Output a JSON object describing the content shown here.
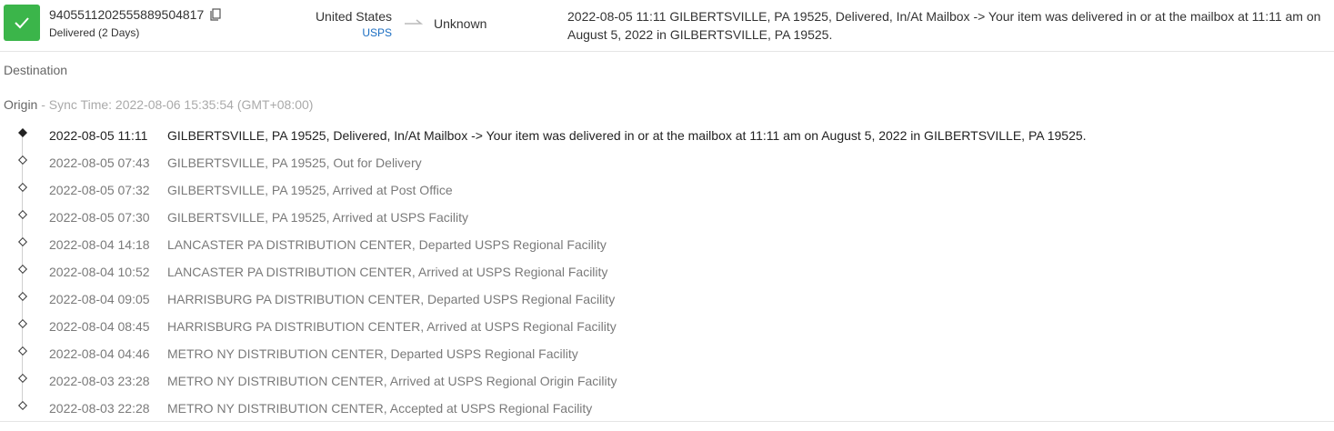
{
  "header": {
    "status_color": "#3bb54a",
    "status_icon": "check-icon",
    "tracking_number": "9405511202555889504817",
    "copy_icon": "copy-icon",
    "status_text": "Delivered (2 Days)",
    "origin_country": "United States",
    "carrier": "USPS",
    "carrier_color": "#1b6ec2",
    "arrow_icon": "arrow-right-icon",
    "destination_country": "Unknown",
    "latest_event": "2022-08-05 11:11  GILBERTSVILLE, PA 19525, Delivered, In/At Mailbox -> Your item was delivered in or at the mailbox at 11:11 am on August 5, 2022 in GILBERTSVILLE, PA 19525."
  },
  "destination": {
    "label": "Destination"
  },
  "origin": {
    "label": "Origin",
    "sync_time": " - Sync Time: 2022-08-06 15:35:54 (GMT+08:00)"
  },
  "events": [
    {
      "time": "2022-08-05 11:11",
      "desc": "GILBERTSVILLE, PA 19525, Delivered, In/At Mailbox -> Your item was delivered in or at the mailbox at 11:11 am on August 5, 2022 in GILBERTSVILLE, PA 19525."
    },
    {
      "time": "2022-08-05 07:43",
      "desc": "GILBERTSVILLE, PA 19525, Out for Delivery"
    },
    {
      "time": "2022-08-05 07:32",
      "desc": "GILBERTSVILLE, PA 19525, Arrived at Post Office"
    },
    {
      "time": "2022-08-05 07:30",
      "desc": "GILBERTSVILLE, PA 19525, Arrived at USPS Facility"
    },
    {
      "time": "2022-08-04 14:18",
      "desc": "LANCASTER PA DISTRIBUTION CENTER, Departed USPS Regional Facility"
    },
    {
      "time": "2022-08-04 10:52",
      "desc": "LANCASTER PA DISTRIBUTION CENTER, Arrived at USPS Regional Facility"
    },
    {
      "time": "2022-08-04 09:05",
      "desc": "HARRISBURG PA DISTRIBUTION CENTER, Departed USPS Regional Facility"
    },
    {
      "time": "2022-08-04 08:45",
      "desc": "HARRISBURG PA DISTRIBUTION CENTER, Arrived at USPS Regional Facility"
    },
    {
      "time": "2022-08-04 04:46",
      "desc": "METRO NY DISTRIBUTION CENTER, Departed USPS Regional Facility"
    },
    {
      "time": "2022-08-03 23:28",
      "desc": "METRO NY DISTRIBUTION CENTER, Arrived at USPS Regional Origin Facility"
    },
    {
      "time": "2022-08-03 22:28",
      "desc": "METRO NY DISTRIBUTION CENTER, Accepted at USPS Regional Facility"
    }
  ]
}
